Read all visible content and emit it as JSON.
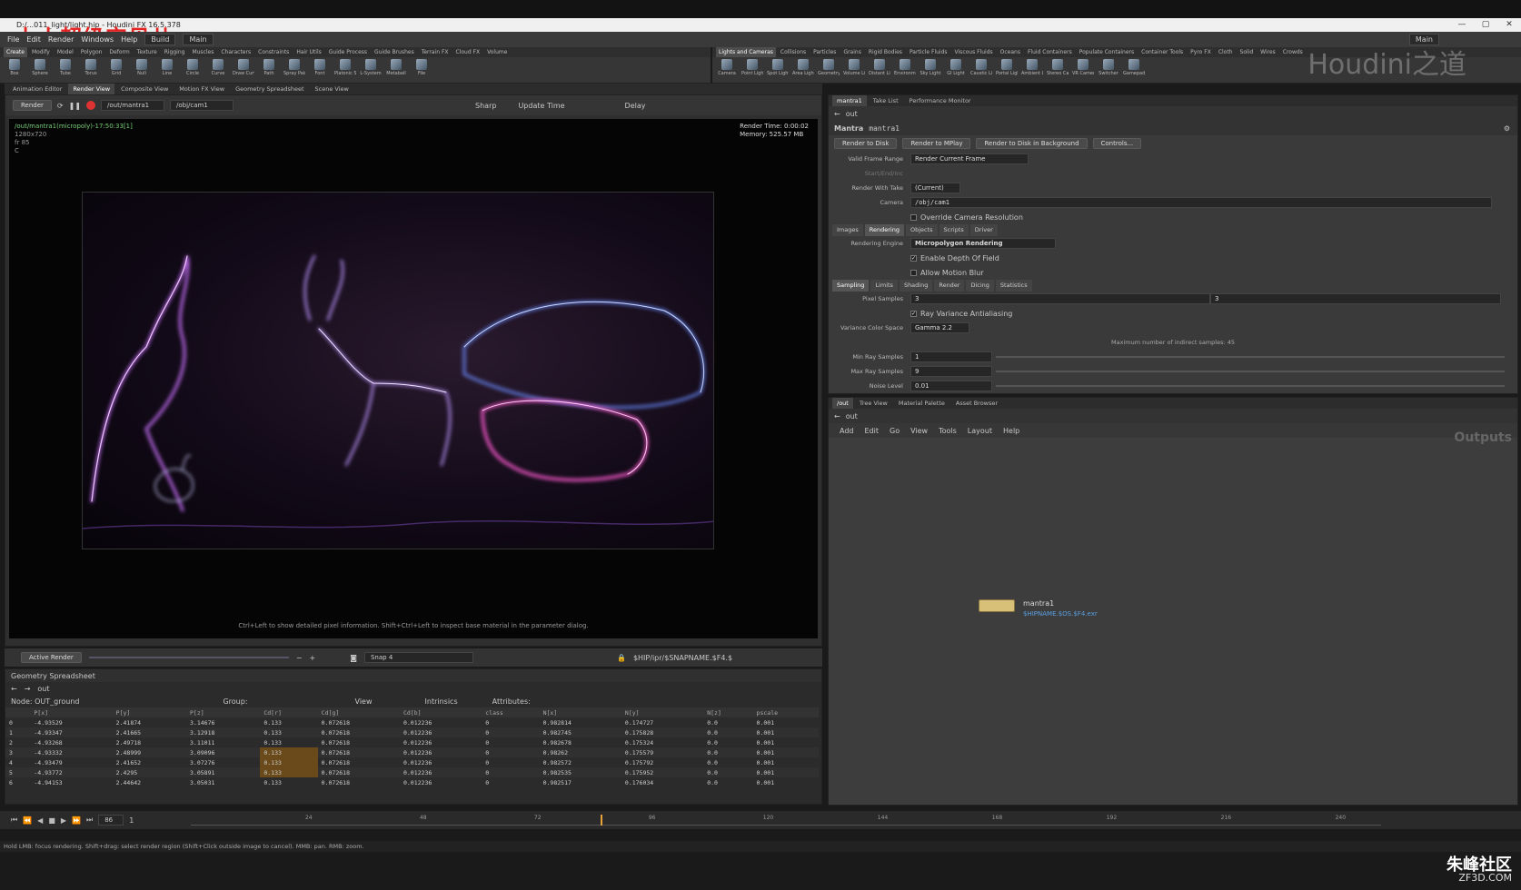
{
  "window": {
    "title": "D:/...011_light/light.hip - Houdini FX 16.5.378",
    "controls": [
      "—",
      "▢",
      "✕"
    ]
  },
  "overlay_text": "小小超级宝贝儿",
  "menubar": {
    "items": [
      "File",
      "Edit",
      "Render",
      "Windows",
      "Help"
    ],
    "build": "Build",
    "desktop": "Main",
    "right_desktop": "Main"
  },
  "left_shelf": {
    "tabs": [
      "Create",
      "Modify",
      "Model",
      "Polygon",
      "Deform",
      "Texture",
      "Rigging",
      "Muscles",
      "Characters",
      "Constraints",
      "Hair Utils",
      "Guide Process",
      "Guide Brushes",
      "Terrain FX",
      "Cloud FX",
      "Volume"
    ],
    "tools": [
      "Box",
      "Sphere",
      "Tube",
      "Torus",
      "Grid",
      "Null",
      "Line",
      "Circle",
      "Curve",
      "Draw Curve",
      "Path",
      "Spray Paint",
      "Font",
      "Platonic Solids",
      "L-System",
      "Metaball",
      "File"
    ]
  },
  "right_shelf": {
    "tabs": [
      "Lights and Cameras",
      "Collisions",
      "Particles",
      "Grains",
      "Rigid Bodies",
      "Particle Fluids",
      "Viscous Fluids",
      "Oceans",
      "Fluid Containers",
      "Populate Containers",
      "Container Tools",
      "Pyro FX",
      "Cloth",
      "Solid",
      "Wires",
      "Crowds"
    ],
    "tools": [
      "Camera",
      "Point Light",
      "Spot Light",
      "Area Light",
      "Geometry Light",
      "Volume Light",
      "Distant Light",
      "Environment Light",
      "Sky Light",
      "GI Light",
      "Caustic Light",
      "Portal Light",
      "Ambient Light",
      "Stereo Camera",
      "VR Camera",
      "Switcher",
      "Gamepad Camera"
    ]
  },
  "brand_watermark": "Houdini之道",
  "left_tabs": [
    "Animation Editor",
    "Render View",
    "Composite View",
    "Motion FX View",
    "Geometry Spreadsheet",
    "Scene View"
  ],
  "viewer": {
    "render_button": "Render",
    "rop_path": "/out/mantra1",
    "camera_path": "/obj/cam1",
    "sharp": "Sharp",
    "update_time": "Update Time",
    "delay": "Delay",
    "info_line1": "/out/mantra1(micropoly)-17:50:33[1]",
    "info_line2": "1280x720",
    "info_line3": "fr 85",
    "info_line4": "C",
    "render_time": "Render Time: 0:00:02",
    "memory": "Memory:   525.57 MB",
    "hint": "Ctrl+Left to show detailed pixel information. Shift+Ctrl+Left to inspect base material in the parameter dialog.",
    "active_render": "Active Render",
    "snap": "Snap 4",
    "output_path": "$HIP/ipr/$SNAPNAME.$F4.$"
  },
  "spreadsheet": {
    "tab": "Geometry Spreadsheet",
    "path": "out",
    "node_label": "Node: OUT_ground",
    "group_label": "Group:",
    "view_label": "View",
    "intrinsics": "Intrinsics",
    "attributes_label": "Attributes:",
    "columns": [
      "",
      "P[x]",
      "P[y]",
      "P[z]",
      "Cd[r]",
      "Cd[g]",
      "Cd[b]",
      "class",
      "N[x]",
      "N[y]",
      "N[z]",
      "pscale"
    ],
    "rows": [
      [
        "0",
        "-4.93529",
        "2.41874",
        "3.14676",
        "0.133",
        "0.072618",
        "0.012236",
        "0",
        "0.982814",
        "0.174727",
        "0.0",
        "0.001"
      ],
      [
        "1",
        "-4.93347",
        "2.41665",
        "3.12918",
        "0.133",
        "0.072618",
        "0.012236",
        "0",
        "0.982745",
        "0.175828",
        "0.0",
        "0.001"
      ],
      [
        "2",
        "-4.93268",
        "2.49718",
        "3.11011",
        "0.133",
        "0.072618",
        "0.012236",
        "0",
        "0.982678",
        "0.175324",
        "0.0",
        "0.001"
      ],
      [
        "3",
        "-4.93332",
        "2.48999",
        "3.09096",
        "0.133",
        "0.072618",
        "0.012236",
        "0",
        "0.98262",
        "0.175579",
        "0.0",
        "0.001"
      ],
      [
        "4",
        "-4.93479",
        "2.41652",
        "3.07276",
        "0.133",
        "0.072618",
        "0.012236",
        "0",
        "0.982572",
        "0.175792",
        "0.0",
        "0.001"
      ],
      [
        "5",
        "-4.93772",
        "2.4295",
        "3.05891",
        "0.133",
        "0.072618",
        "0.012236",
        "0",
        "0.982535",
        "0.175952",
        "0.0",
        "0.001"
      ],
      [
        "6",
        "-4.94153",
        "2.44642",
        "3.05031",
        "0.133",
        "0.072618",
        "0.012236",
        "0",
        "0.982517",
        "0.176034",
        "0.0",
        "0.001"
      ]
    ]
  },
  "param": {
    "tabs": [
      "mantra1",
      "Take List",
      "Performance Monitor"
    ],
    "path": "out",
    "node_type": "Mantra",
    "node_name": "mantra1",
    "buttons": [
      "Render to Disk",
      "Render to MPlay",
      "Render to Disk in Background",
      "Controls..."
    ],
    "valid_frame_range_label": "Valid Frame Range",
    "valid_frame_range": "Render Current Frame",
    "start_end_label": "Start/End/Inc",
    "render_with_take_label": "Render With Take",
    "render_with_take": "(Current)",
    "camera_label": "Camera",
    "camera": "/obj/cam1",
    "override_res": "Override Camera Resolution",
    "main_tabs": [
      "Images",
      "Rendering",
      "Objects",
      "Scripts",
      "Driver"
    ],
    "engine_label": "Rendering Engine",
    "engine": "Micropolygon Rendering",
    "dof": "Enable Depth Of Field",
    "motion_blur": "Allow Motion Blur",
    "sub_tabs": [
      "Sampling",
      "Limits",
      "Shading",
      "Render",
      "Dicing",
      "Statistics"
    ],
    "pixel_samples_label": "Pixel Samples",
    "pixel_samples_x": "3",
    "pixel_samples_y": "3",
    "ray_variance": "Ray Variance Antialiasing",
    "variance_color_label": "Variance Color Space",
    "variance_color": "Gamma 2.2",
    "max_indirect": "Maximum number of indirect samples: 45",
    "min_ray_label": "Min Ray Samples",
    "min_ray": "1",
    "max_ray_label": "Max Ray Samples",
    "max_ray": "9",
    "noise_label": "Noise Level",
    "noise": "0.01"
  },
  "network": {
    "tabs": [
      "/out",
      "Tree View",
      "Material Palette",
      "Asset Browser"
    ],
    "path": "out",
    "menu": [
      "Add",
      "Edit",
      "Go",
      "View",
      "Tools",
      "Layout",
      "Help"
    ],
    "outputs_label": "Outputs",
    "node_name": "mantra1",
    "node_path": "$HIPNAME.$OS.$F4.exr"
  },
  "timeline": {
    "current_frame": "86",
    "start": "1",
    "ticks": [
      "24",
      "48",
      "72",
      "96",
      "120",
      "144",
      "168",
      "192",
      "216",
      "240"
    ]
  },
  "status_text": "Hold LMB: focus rendering. Shift+drag: select render region (Shift+Click outside image to cancel). MMB: pan. RMB: zoom.",
  "site_logo": "朱峰社区",
  "site_sub": "ZF3D.COM"
}
